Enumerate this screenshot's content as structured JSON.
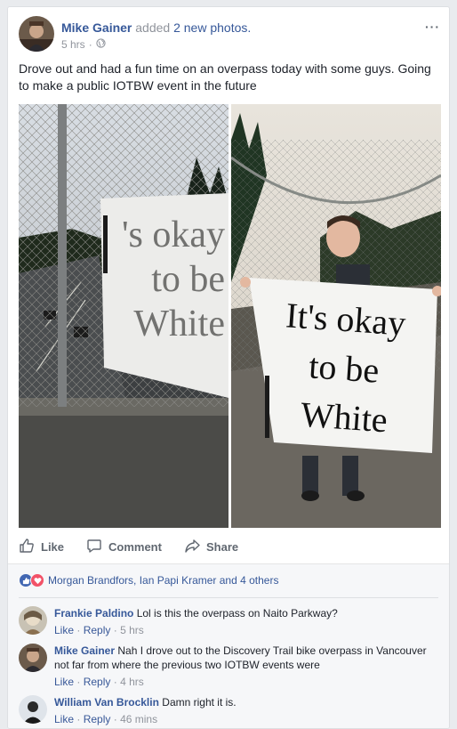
{
  "post": {
    "author": "Mike Gainer",
    "action_prefix": "added",
    "action_link": "2 new photos.",
    "time": "5 hrs",
    "time_sep": "·",
    "more": "···",
    "text": "Drove out and had a fun time on an overpass today with some guys. Going to make a public IOTBW event in the future"
  },
  "photos": {
    "photo1_banner": [
      "'s okay",
      "to be",
      "White"
    ],
    "photo2_banner": [
      "It's okay",
      "to be",
      "White"
    ]
  },
  "actions": {
    "like": "Like",
    "comment": "Comment",
    "share": "Share"
  },
  "reactions": {
    "summary": "Morgan Brandfors, Ian Papi Kramer and 4 others"
  },
  "comments": [
    {
      "name": "Frankie Paldino",
      "text": "Lol is this the overpass on Naito Parkway?",
      "like": "Like",
      "reply": "Reply",
      "sep": "·",
      "time": "5 hrs"
    },
    {
      "name": "Mike Gainer",
      "text": "Nah I drove out to the Discovery Trail bike overpass in Vancouver not far from where the previous two IOTBW events were",
      "like": "Like",
      "reply": "Reply",
      "sep": "·",
      "time": "4 hrs"
    },
    {
      "name": "William Van Brocklin",
      "text": "Damn right it is.",
      "like": "Like",
      "reply": "Reply",
      "sep": "·",
      "time": "46 mins"
    }
  ],
  "colors": {
    "link": "#365899",
    "meta": "#90949c",
    "like_blue": "#4267b2",
    "love_red": "#f25268",
    "bg": "#e9ebee"
  }
}
